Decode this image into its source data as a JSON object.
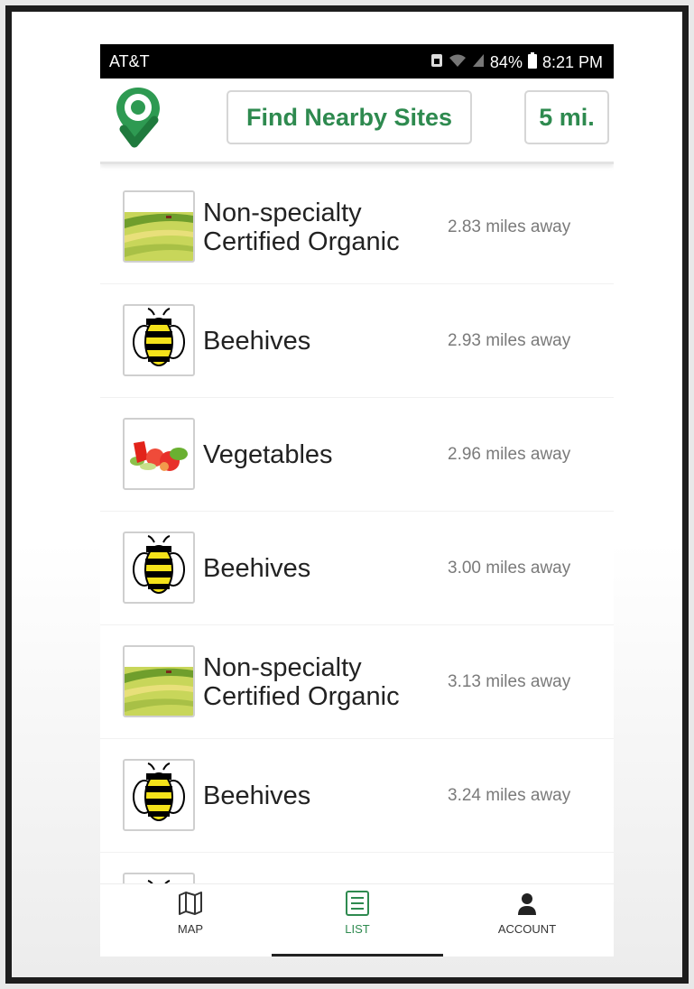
{
  "status_bar": {
    "carrier": "AT&T",
    "battery": "84%",
    "time": "8:21 PM",
    "icons": [
      "sim-icon",
      "wifi-icon",
      "signal-icon",
      "battery-icon"
    ]
  },
  "header": {
    "logo_icon": "location-check-logo-icon",
    "find_button_label": "Find Nearby Sites",
    "radius_label": "5 mi.",
    "accent_color": "#2e8a4f"
  },
  "sites": [
    {
      "category": "Non-specialty Certified Organic",
      "title_line1": "Non-specialty",
      "title_line2": "Certified Organic",
      "distance": "2.83 miles away",
      "icon": "farm-field-icon"
    },
    {
      "category": "Beehives",
      "title_line1": "Beehives",
      "title_line2": "",
      "distance": "2.93 miles away",
      "icon": "bee-icon"
    },
    {
      "category": "Vegetables",
      "title_line1": "Vegetables",
      "title_line2": "",
      "distance": "2.96 miles away",
      "icon": "vegetables-icon"
    },
    {
      "category": "Beehives",
      "title_line1": "Beehives",
      "title_line2": "",
      "distance": "3.00 miles away",
      "icon": "bee-icon"
    },
    {
      "category": "Non-specialty Certified Organic",
      "title_line1": "Non-specialty",
      "title_line2": "Certified Organic",
      "distance": "3.13 miles away",
      "icon": "farm-field-icon"
    },
    {
      "category": "Beehives",
      "title_line1": "Beehives",
      "title_line2": "",
      "distance": "3.24 miles away",
      "icon": "bee-icon"
    }
  ],
  "bottom_nav": {
    "items": [
      {
        "label": "MAP",
        "icon": "map-icon"
      },
      {
        "label": "LIST",
        "icon": "list-icon",
        "active": true
      },
      {
        "label": "ACCOUNT",
        "icon": "account-icon"
      }
    ]
  }
}
